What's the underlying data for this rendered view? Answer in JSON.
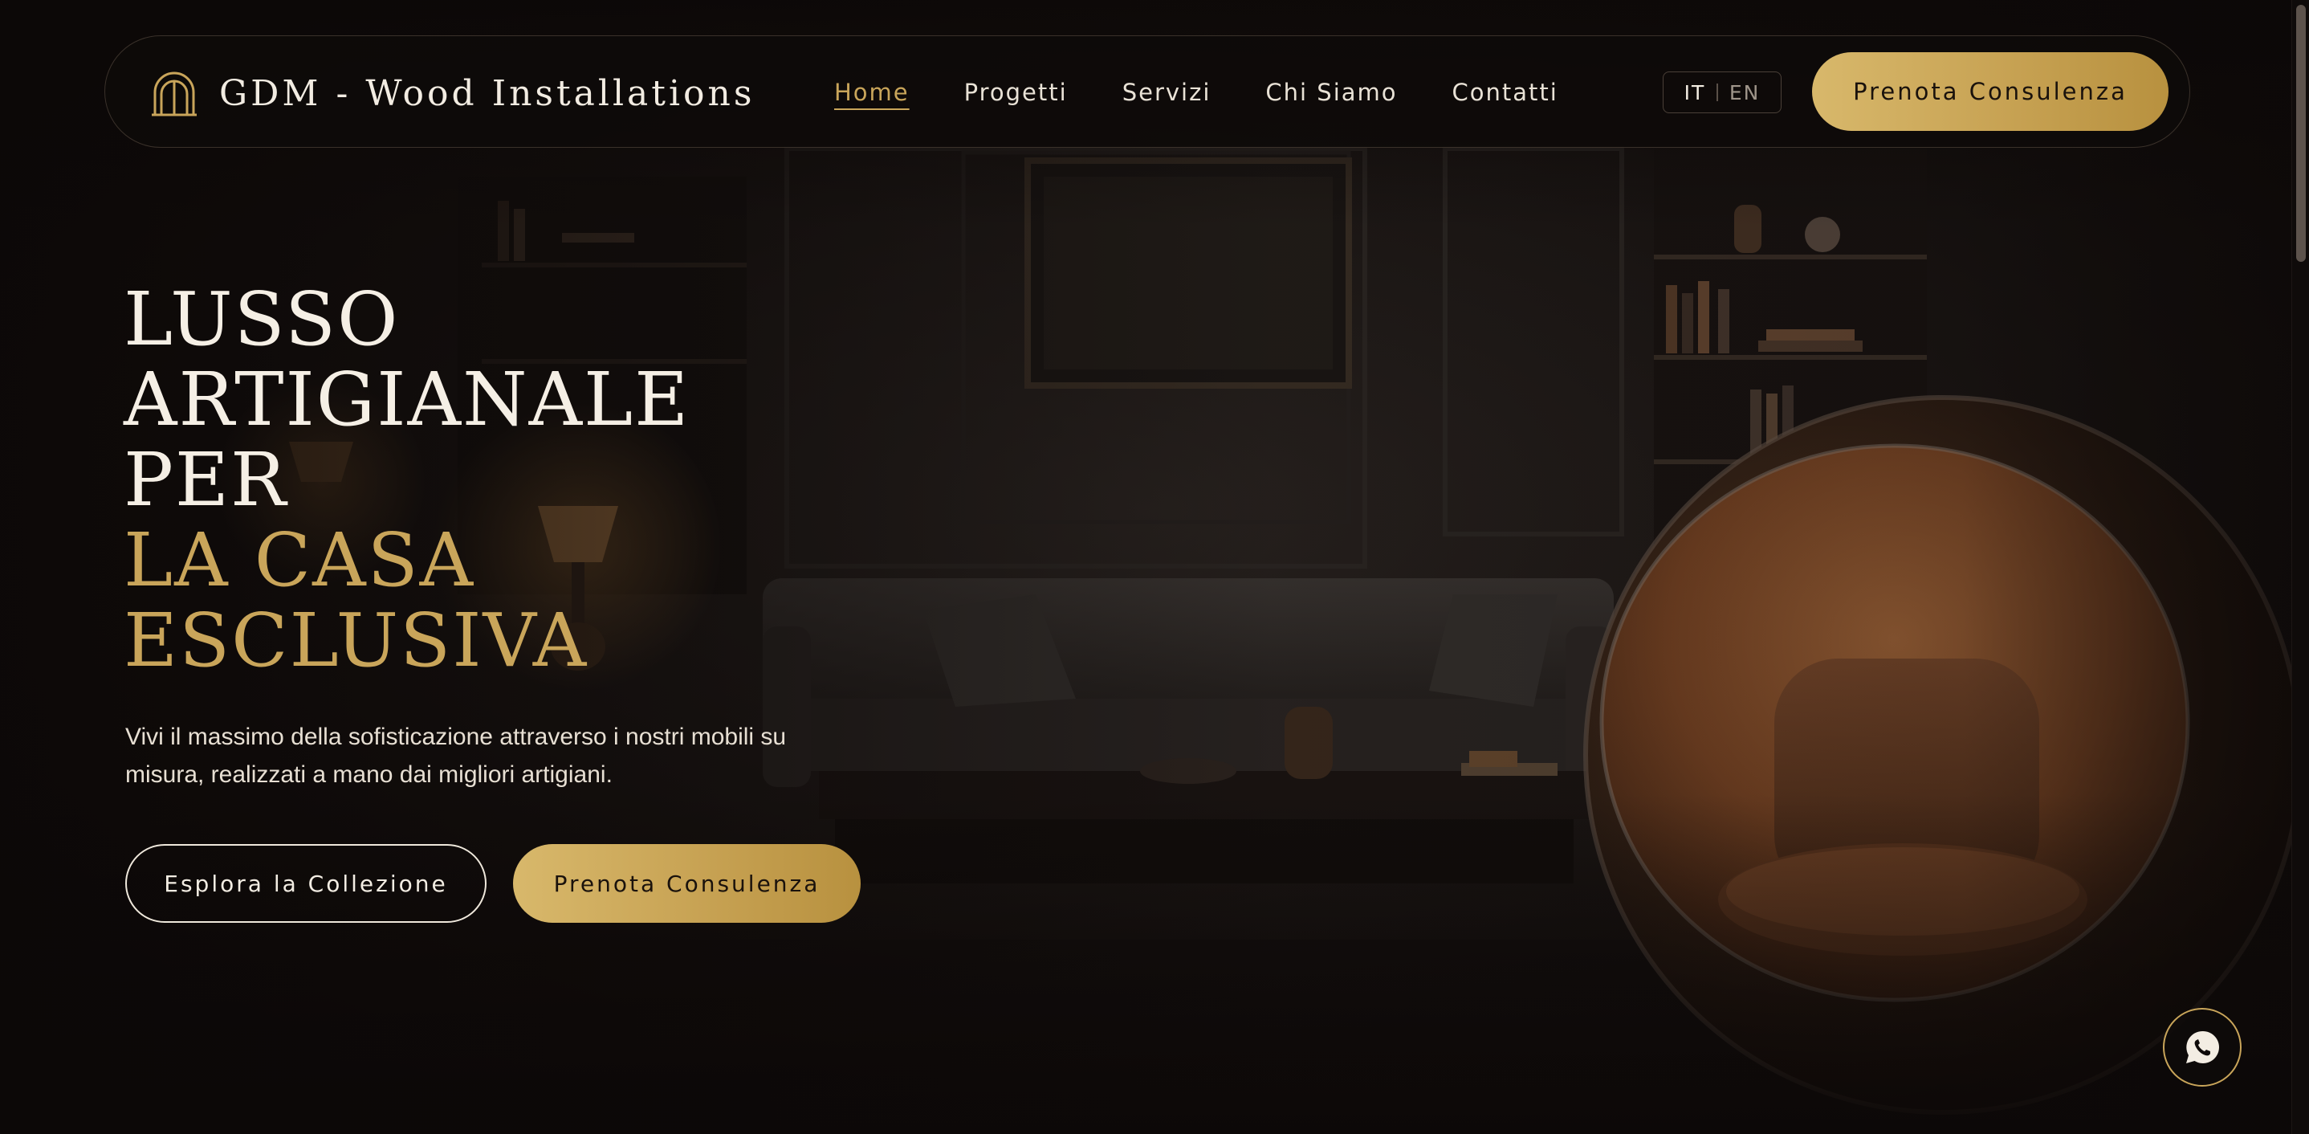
{
  "brand": {
    "name": "GDM - Wood Installations",
    "icon": "arch-door-icon"
  },
  "nav": {
    "items": [
      {
        "label": "Home",
        "active": true
      },
      {
        "label": "Progetti",
        "active": false
      },
      {
        "label": "Servizi",
        "active": false
      },
      {
        "label": "Chi Siamo",
        "active": false
      },
      {
        "label": "Contatti",
        "active": false
      }
    ],
    "languages": [
      {
        "code": "IT",
        "selected": true
      },
      {
        "code": "EN",
        "selected": false
      }
    ],
    "cta_label": "Prenota Consulenza"
  },
  "hero": {
    "title_lines": [
      "LUSSO",
      "ARTIGIANALE",
      "PER"
    ],
    "title_accent_lines": [
      "LA CASA",
      "ESCLUSIVA"
    ],
    "subtitle": "Vivi il massimo della sofisticazione attraverso i nostri mobili su misura, realizzati a mano dai migliori artigiani.",
    "secondary_button": "Esplora la Collezione",
    "primary_button": "Prenota Consulenza"
  },
  "chat": {
    "icon": "whatsapp-icon"
  },
  "colors": {
    "background": "#0c0807",
    "gold": "#c9a55a",
    "text": "#f3ede3"
  }
}
